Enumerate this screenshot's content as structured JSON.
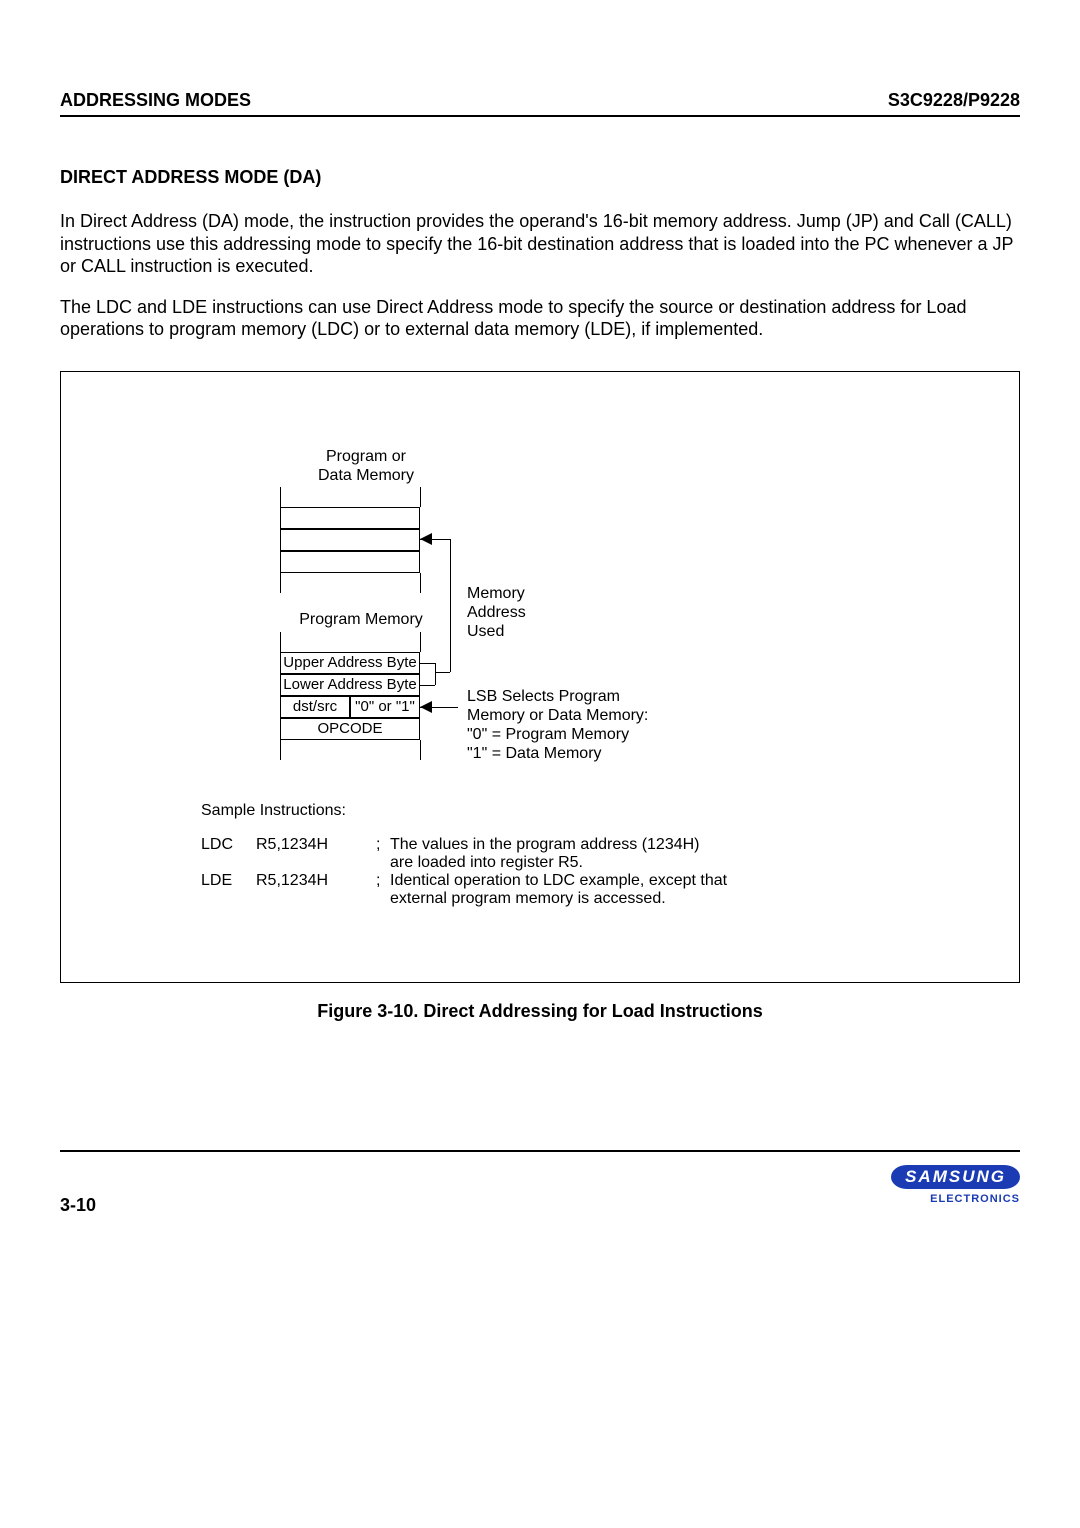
{
  "header": {
    "left": "ADDRESSING MODES",
    "right": "S3C9228/P9228"
  },
  "section_title": "DIRECT ADDRESS MODE (DA)",
  "para1": "In Direct Address (DA) mode, the instruction provides the operand's 16-bit memory address. Jump (JP) and Call (CALL) instructions use this addressing mode to specify the 16-bit destination address that is loaded into the PC whenever a JP or CALL instruction is executed.",
  "para2": "The LDC and LDE instructions can use Direct Address mode to specify the source or destination address for Load operations to program memory (LDC) or to external data memory (LDE), if implemented.",
  "diagram": {
    "top_label_l1": "Program  or",
    "top_label_l2": "Data Memory",
    "pm_label": "Program Memory",
    "uab": "Upper Address Byte",
    "lab": "Lower Address Byte",
    "dstsrc": "dst/src",
    "zero_one": "\"0\" or \"1\"",
    "opcode": "OPCODE",
    "mem_l1": "Memory",
    "mem_l2": "Address",
    "mem_l3": "Used",
    "lsb_l1": "LSB Selects Program",
    "lsb_l2": "Memory or Data Memory:",
    "lsb_l3": "\"0\" = Program Memory",
    "lsb_l4": "\"1\" = Data Memory"
  },
  "sample": {
    "title": "Sample Instructions:",
    "rows": [
      {
        "mn": "LDC",
        "op": "R5,1234H",
        "sc": ";",
        "c1": "The values in the program address (1234H)",
        "c2": "are loaded into register R5."
      },
      {
        "mn": "LDE",
        "op": "R5,1234H",
        "sc": ";",
        "c1": "Identical operation to LDC example, except that",
        "c2": "external program memory is accessed."
      }
    ]
  },
  "fig_caption": "Figure 3-10. Direct Addressing for Load Instructions",
  "page_number": "3-10",
  "logo_main": "SAMSUNG",
  "logo_sub": "ELECTRONICS"
}
